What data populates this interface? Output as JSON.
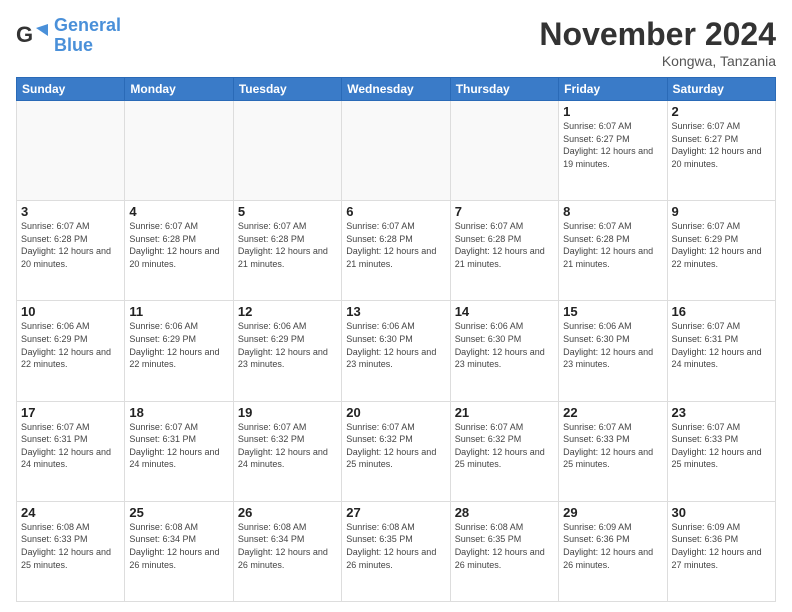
{
  "logo": {
    "line1": "General",
    "line2": "Blue"
  },
  "title": "November 2024",
  "location": "Kongwa, Tanzania",
  "days_of_week": [
    "Sunday",
    "Monday",
    "Tuesday",
    "Wednesday",
    "Thursday",
    "Friday",
    "Saturday"
  ],
  "weeks": [
    [
      {
        "day": "",
        "info": ""
      },
      {
        "day": "",
        "info": ""
      },
      {
        "day": "",
        "info": ""
      },
      {
        "day": "",
        "info": ""
      },
      {
        "day": "",
        "info": ""
      },
      {
        "day": "1",
        "info": "Sunrise: 6:07 AM\nSunset: 6:27 PM\nDaylight: 12 hours and 19 minutes."
      },
      {
        "day": "2",
        "info": "Sunrise: 6:07 AM\nSunset: 6:27 PM\nDaylight: 12 hours and 20 minutes."
      }
    ],
    [
      {
        "day": "3",
        "info": "Sunrise: 6:07 AM\nSunset: 6:28 PM\nDaylight: 12 hours and 20 minutes."
      },
      {
        "day": "4",
        "info": "Sunrise: 6:07 AM\nSunset: 6:28 PM\nDaylight: 12 hours and 20 minutes."
      },
      {
        "day": "5",
        "info": "Sunrise: 6:07 AM\nSunset: 6:28 PM\nDaylight: 12 hours and 21 minutes."
      },
      {
        "day": "6",
        "info": "Sunrise: 6:07 AM\nSunset: 6:28 PM\nDaylight: 12 hours and 21 minutes."
      },
      {
        "day": "7",
        "info": "Sunrise: 6:07 AM\nSunset: 6:28 PM\nDaylight: 12 hours and 21 minutes."
      },
      {
        "day": "8",
        "info": "Sunrise: 6:07 AM\nSunset: 6:28 PM\nDaylight: 12 hours and 21 minutes."
      },
      {
        "day": "9",
        "info": "Sunrise: 6:07 AM\nSunset: 6:29 PM\nDaylight: 12 hours and 22 minutes."
      }
    ],
    [
      {
        "day": "10",
        "info": "Sunrise: 6:06 AM\nSunset: 6:29 PM\nDaylight: 12 hours and 22 minutes."
      },
      {
        "day": "11",
        "info": "Sunrise: 6:06 AM\nSunset: 6:29 PM\nDaylight: 12 hours and 22 minutes."
      },
      {
        "day": "12",
        "info": "Sunrise: 6:06 AM\nSunset: 6:29 PM\nDaylight: 12 hours and 23 minutes."
      },
      {
        "day": "13",
        "info": "Sunrise: 6:06 AM\nSunset: 6:30 PM\nDaylight: 12 hours and 23 minutes."
      },
      {
        "day": "14",
        "info": "Sunrise: 6:06 AM\nSunset: 6:30 PM\nDaylight: 12 hours and 23 minutes."
      },
      {
        "day": "15",
        "info": "Sunrise: 6:06 AM\nSunset: 6:30 PM\nDaylight: 12 hours and 23 minutes."
      },
      {
        "day": "16",
        "info": "Sunrise: 6:07 AM\nSunset: 6:31 PM\nDaylight: 12 hours and 24 minutes."
      }
    ],
    [
      {
        "day": "17",
        "info": "Sunrise: 6:07 AM\nSunset: 6:31 PM\nDaylight: 12 hours and 24 minutes."
      },
      {
        "day": "18",
        "info": "Sunrise: 6:07 AM\nSunset: 6:31 PM\nDaylight: 12 hours and 24 minutes."
      },
      {
        "day": "19",
        "info": "Sunrise: 6:07 AM\nSunset: 6:32 PM\nDaylight: 12 hours and 24 minutes."
      },
      {
        "day": "20",
        "info": "Sunrise: 6:07 AM\nSunset: 6:32 PM\nDaylight: 12 hours and 25 minutes."
      },
      {
        "day": "21",
        "info": "Sunrise: 6:07 AM\nSunset: 6:32 PM\nDaylight: 12 hours and 25 minutes."
      },
      {
        "day": "22",
        "info": "Sunrise: 6:07 AM\nSunset: 6:33 PM\nDaylight: 12 hours and 25 minutes."
      },
      {
        "day": "23",
        "info": "Sunrise: 6:07 AM\nSunset: 6:33 PM\nDaylight: 12 hours and 25 minutes."
      }
    ],
    [
      {
        "day": "24",
        "info": "Sunrise: 6:08 AM\nSunset: 6:33 PM\nDaylight: 12 hours and 25 minutes."
      },
      {
        "day": "25",
        "info": "Sunrise: 6:08 AM\nSunset: 6:34 PM\nDaylight: 12 hours and 26 minutes."
      },
      {
        "day": "26",
        "info": "Sunrise: 6:08 AM\nSunset: 6:34 PM\nDaylight: 12 hours and 26 minutes."
      },
      {
        "day": "27",
        "info": "Sunrise: 6:08 AM\nSunset: 6:35 PM\nDaylight: 12 hours and 26 minutes."
      },
      {
        "day": "28",
        "info": "Sunrise: 6:08 AM\nSunset: 6:35 PM\nDaylight: 12 hours and 26 minutes."
      },
      {
        "day": "29",
        "info": "Sunrise: 6:09 AM\nSunset: 6:36 PM\nDaylight: 12 hours and 26 minutes."
      },
      {
        "day": "30",
        "info": "Sunrise: 6:09 AM\nSunset: 6:36 PM\nDaylight: 12 hours and 27 minutes."
      }
    ]
  ]
}
